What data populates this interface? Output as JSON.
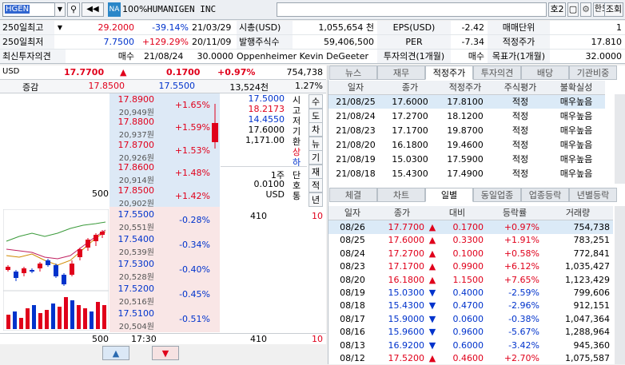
{
  "toolbar": {
    "code": "HGEN",
    "badge": "NA",
    "zoom": "100%",
    "name": "HUMANIGEN INC",
    "ho": "호2",
    "han": "한도",
    "jo": "조회"
  },
  "info": {
    "r1": {
      "l1": "250일최고",
      "v1": "29.2000",
      "p1": "-39.14%",
      "d1": "21/03/29",
      "l2": "시총(USD)",
      "v2": "1,055,654 천",
      "l3": "EPS(USD)",
      "v3": "-2.42",
      "l4": "매매단위",
      "v4": "1"
    },
    "r2": {
      "l1": "250일최저",
      "v1": "7.7500",
      "p1": "+129.29%",
      "d1": "20/11/09",
      "l2": "발행주식수",
      "v2": "59,406,500",
      "l3": "PER",
      "v3": "-7.34",
      "l4": "적정주가",
      "v4": "17.810"
    },
    "r3": {
      "l1": "최신투자의견",
      "v1": "매수",
      "d1": "21/08/24",
      "p1": "30.0000",
      "an": "Oppenheimer Kevin DeGeeter",
      "l3": "투자의견(1개월)",
      "v3": "매수",
      "l4": "목표가(1개월)",
      "v4": "32.0000"
    }
  },
  "quote": {
    "cur": "USD",
    "price": "17.7700",
    "chg": "0.1700",
    "pct": "+0.97%",
    "vol": "754,738",
    "lbl": "증감",
    "hi": "17.8500",
    "lo": "17.5500",
    "amt": "13,524천",
    "rate": "1.27%"
  },
  "orderbook": {
    "asks": [
      {
        "p": "17.8900",
        "k": "20,949원",
        "c": "+1.65%"
      },
      {
        "p": "17.8800",
        "k": "20,937원",
        "c": "+1.59%"
      },
      {
        "p": "17.8700",
        "k": "20,926원",
        "c": "+1.53%"
      },
      {
        "p": "17.8600",
        "k": "20,914원",
        "c": "+1.48%"
      },
      {
        "p": "17.8500",
        "k": "20,902원",
        "c": "+1.42%"
      }
    ],
    "bids": [
      {
        "p": "17.5500",
        "k": "20,551원",
        "c": "-0.28%"
      },
      {
        "p": "17.5400",
        "k": "20,539원",
        "c": "-0.34%"
      },
      {
        "p": "17.5300",
        "k": "20,528원",
        "c": "-0.40%"
      },
      {
        "p": "17.5200",
        "k": "20,516원",
        "c": "-0.45%"
      },
      {
        "p": "17.5100",
        "k": "20,504원",
        "c": "-0.51%"
      }
    ],
    "ask_qty": "500",
    "bid_qty": "410",
    "bid_cnt": "10",
    "side": {
      "v1": "17.5000",
      "v2": "18.2173",
      "v3": "14.4550",
      "v4": "17.6000",
      "v5": "1,171.00",
      "l1": "시",
      "l2": "고",
      "l3": "저",
      "l4": "기",
      "l5": "환",
      "l6": "상",
      "l7": "하"
    },
    "unit": {
      "u1": "1주",
      "u2": "0.0100",
      "u3": "USD",
      "l1": "단",
      "l2": "호",
      "l3": "통"
    },
    "vbtns": [
      "수",
      "도",
      "차",
      "뉴",
      "기",
      "재",
      "적",
      "년"
    ],
    "foot": {
      "a": "500",
      "t": "17:30",
      "b": "410",
      "c": "10"
    }
  },
  "tabs1": [
    "뉴스",
    "재무",
    "적정주가",
    "투자의견",
    "배당",
    "기관비중"
  ],
  "valuation": {
    "headers": [
      "일자",
      "종가",
      "적정주가",
      "주식평가",
      "불확실성"
    ],
    "rows": [
      [
        "21/08/25",
        "17.6000",
        "17.8100",
        "적정",
        "매우높음"
      ],
      [
        "21/08/24",
        "17.2700",
        "18.1200",
        "적정",
        "매우높음"
      ],
      [
        "21/08/23",
        "17.1700",
        "19.8700",
        "적정",
        "매우높음"
      ],
      [
        "21/08/20",
        "16.1800",
        "19.4600",
        "적정",
        "매우높음"
      ],
      [
        "21/08/19",
        "15.0300",
        "17.5900",
        "적정",
        "매우높음"
      ],
      [
        "21/08/18",
        "15.4300",
        "17.4900",
        "적정",
        "매우높음"
      ]
    ]
  },
  "tabs2": [
    "체결",
    "차트",
    "일별",
    "동일업종",
    "업종등락",
    "년별등락"
  ],
  "daily": {
    "headers": [
      "일자",
      "종가",
      "대비",
      "등락률",
      "거래량"
    ],
    "rows": [
      [
        "08/26",
        "17.7700",
        "up",
        "0.1700",
        "+0.97%",
        "754,738"
      ],
      [
        "08/25",
        "17.6000",
        "up",
        "0.3300",
        "+1.91%",
        "783,251"
      ],
      [
        "08/24",
        "17.2700",
        "up",
        "0.1000",
        "+0.58%",
        "772,841"
      ],
      [
        "08/23",
        "17.1700",
        "up",
        "0.9900",
        "+6.12%",
        "1,035,427"
      ],
      [
        "08/20",
        "16.1800",
        "up",
        "1.1500",
        "+7.65%",
        "1,123,429"
      ],
      [
        "08/19",
        "15.0300",
        "down",
        "0.4000",
        "-2.59%",
        "799,606"
      ],
      [
        "08/18",
        "15.4300",
        "down",
        "0.4700",
        "-2.96%",
        "912,151"
      ],
      [
        "08/17",
        "15.9000",
        "down",
        "0.0600",
        "-0.38%",
        "1,047,364"
      ],
      [
        "08/16",
        "15.9600",
        "down",
        "0.9600",
        "-5.67%",
        "1,288,964"
      ],
      [
        "08/13",
        "16.9200",
        "down",
        "0.6000",
        "-3.42%",
        "945,360"
      ],
      [
        "08/12",
        "17.5200",
        "up",
        "0.4600",
        "+2.70%",
        "1,075,587"
      ]
    ]
  },
  "colors": {
    "up": "#e0001b",
    "down": "#0033cc"
  }
}
